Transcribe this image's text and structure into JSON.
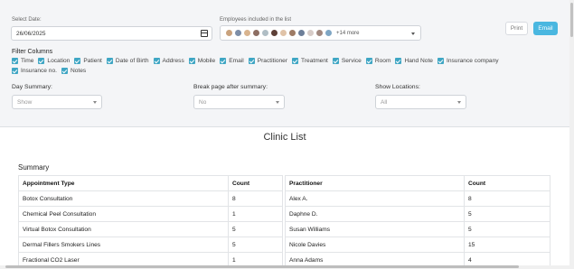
{
  "date": {
    "label": "Select Date:",
    "value": "26/06/2025"
  },
  "employees": {
    "label": "Employees included in the list",
    "avatar_colors": [
      "#c9a27d",
      "#7d8ea8",
      "#d9b48f",
      "#8d6e63",
      "#b0bec5",
      "#5d4037",
      "#e0c3a8",
      "#9e7b65",
      "#6d7f99",
      "#d7ccc8",
      "#a1887f",
      "#7fa6c4"
    ],
    "more": "+14 more"
  },
  "buttons": {
    "print": "Print",
    "email": "Email"
  },
  "filter_columns": {
    "title": "Filter Columns",
    "row1": [
      "Time",
      "Location",
      "Patient",
      "Date of Birth",
      "Address",
      "Mobile",
      "Email",
      "Practitioner",
      "Treatment",
      "Service",
      "Room",
      "Hand Note",
      "Insurance company"
    ],
    "row2": [
      "Insurance no.",
      "Notes"
    ]
  },
  "day_summary": {
    "label": "Day Summary:",
    "value": "Show"
  },
  "break_page": {
    "label": "Break page after summary:",
    "value": "No"
  },
  "show_locations": {
    "label": "Show Locations:",
    "value": "All"
  },
  "clinic_title": "Clinic List",
  "summary_title": "Summary",
  "appointments_table": {
    "headers": [
      "Appointment Type",
      "Count"
    ],
    "rows": [
      [
        "Botox Consultation",
        "8"
      ],
      [
        "Chemical Peel Consultation",
        "1"
      ],
      [
        "Virtual Botox Consultation",
        "5"
      ],
      [
        "Dermal Fillers Smokers Lines",
        "5"
      ],
      [
        "Fractional CO2 Laser",
        "1"
      ]
    ]
  },
  "practitioners_table": {
    "headers": [
      "Practitioner",
      "Count"
    ],
    "rows": [
      [
        "Alex A.",
        "8"
      ],
      [
        "Daphne D.",
        "5"
      ],
      [
        "Susan Williams",
        "5"
      ],
      [
        "Nicole Davies",
        "15"
      ],
      [
        "Anna Adams",
        "4"
      ]
    ]
  }
}
